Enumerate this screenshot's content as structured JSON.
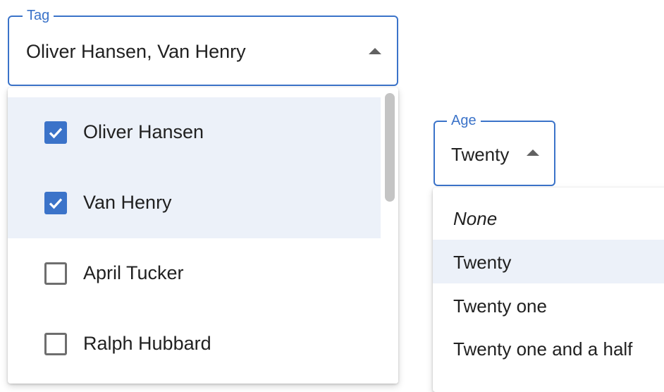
{
  "tag_select": {
    "label": "Tag",
    "value": "Oliver Hansen, Van Henry",
    "options": [
      {
        "label": "Oliver Hansen",
        "checked": true
      },
      {
        "label": "Van Henry",
        "checked": true
      },
      {
        "label": "April Tucker",
        "checked": false
      },
      {
        "label": "Ralph Hubbard",
        "checked": false
      }
    ]
  },
  "age_select": {
    "label": "Age",
    "value": "Twenty",
    "options": [
      {
        "label": "None",
        "selected": false
      },
      {
        "label": "Twenty",
        "selected": true
      },
      {
        "label": "Twenty one",
        "selected": false
      },
      {
        "label": "Twenty one and a half",
        "selected": false
      }
    ]
  },
  "colors": {
    "accent": "#3b73c9",
    "selected_background": "#ecf1f9",
    "text": "#212121"
  },
  "icons": {
    "caret": "arrow-drop-up-icon",
    "check": "check-icon"
  }
}
